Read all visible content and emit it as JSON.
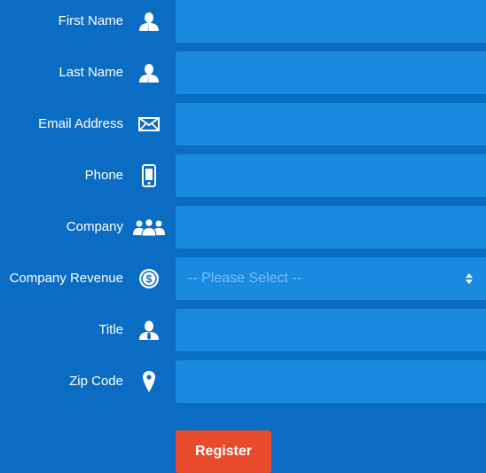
{
  "form": {
    "fields": [
      {
        "label": "First Name",
        "icon": "user-icon",
        "value": ""
      },
      {
        "label": "Last Name",
        "icon": "user-icon",
        "value": ""
      },
      {
        "label": "Email Address",
        "icon": "envelope-icon",
        "value": ""
      },
      {
        "label": "Phone",
        "icon": "smartphone-icon",
        "value": ""
      },
      {
        "label": "Company",
        "icon": "group-icon",
        "value": ""
      },
      {
        "label": "Company Revenue",
        "icon": "dollar-circle-icon",
        "selected": "-- Please Select --"
      },
      {
        "label": "Title",
        "icon": "user-tie-icon",
        "value": ""
      },
      {
        "label": "Zip Code",
        "icon": "map-pin-icon",
        "value": ""
      }
    ],
    "submit_label": "Register"
  },
  "colors": {
    "background": "#0b6cc4",
    "field": "#1a8ae0",
    "button": "#e84a2c",
    "text": "#ffffff",
    "placeholder": "#7fbdf0"
  }
}
